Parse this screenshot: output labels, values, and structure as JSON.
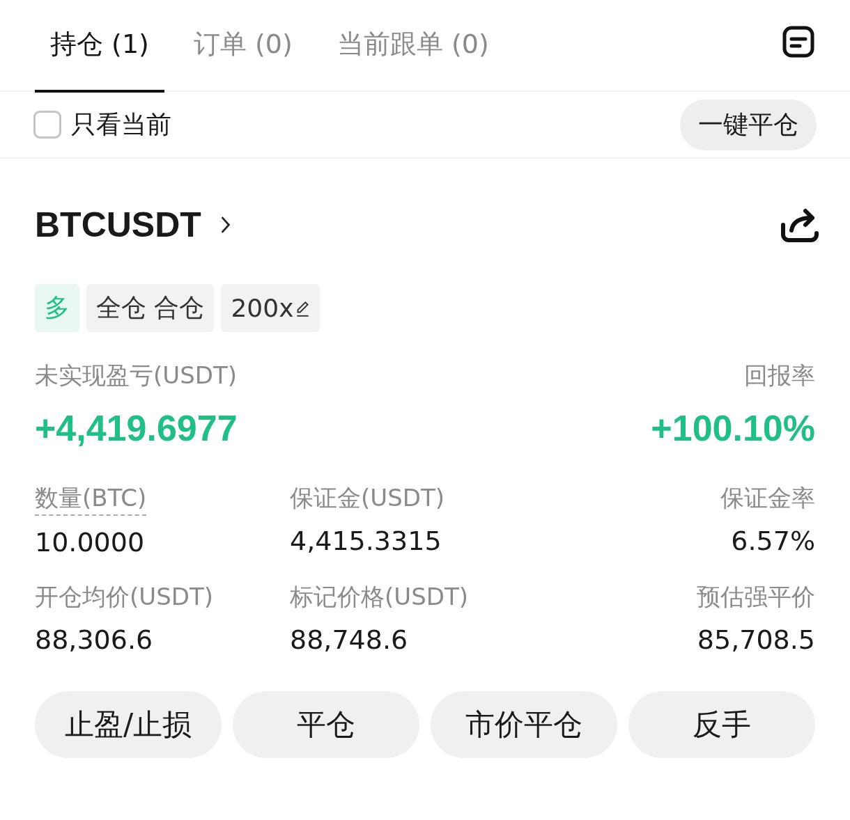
{
  "tabs": [
    {
      "label": "持仓 (1)",
      "selected": true
    },
    {
      "label": "订单 (0)",
      "selected": false
    },
    {
      "label": "当前跟单 (0)",
      "selected": false
    }
  ],
  "filter": {
    "label": "只看当前",
    "checked": false
  },
  "close_all_button": "一键平仓",
  "position": {
    "symbol": "BTCUSDT",
    "tags": [
      {
        "kind": "side",
        "label": "多"
      },
      {
        "kind": "plain",
        "label": "全仓 合仓"
      },
      {
        "kind": "leverage",
        "label": "200x"
      }
    ],
    "pnl": {
      "label": "未实现盈亏(USDT)",
      "value": "+4,419.6977"
    },
    "roe": {
      "label": "回报率",
      "value": "+100.10%"
    },
    "stats": [
      {
        "label": "数量(BTC)",
        "value": "10.0000",
        "kind": "hint"
      },
      {
        "label": "保证金(USDT)",
        "value": "4,415.3315",
        "kind": "plain"
      },
      {
        "label": "保证金率",
        "value": "6.57%",
        "kind": "plain"
      },
      {
        "label": "开仓均价(USDT)",
        "value": "88,306.6",
        "kind": "plain"
      },
      {
        "label": "标记价格(USDT)",
        "value": "88,748.6",
        "kind": "plain"
      },
      {
        "label": "预估强平价",
        "value": "85,708.5",
        "kind": "plain"
      }
    ],
    "buttons": [
      "止盈/止损",
      "平仓",
      "市价平仓",
      "反手"
    ]
  }
}
